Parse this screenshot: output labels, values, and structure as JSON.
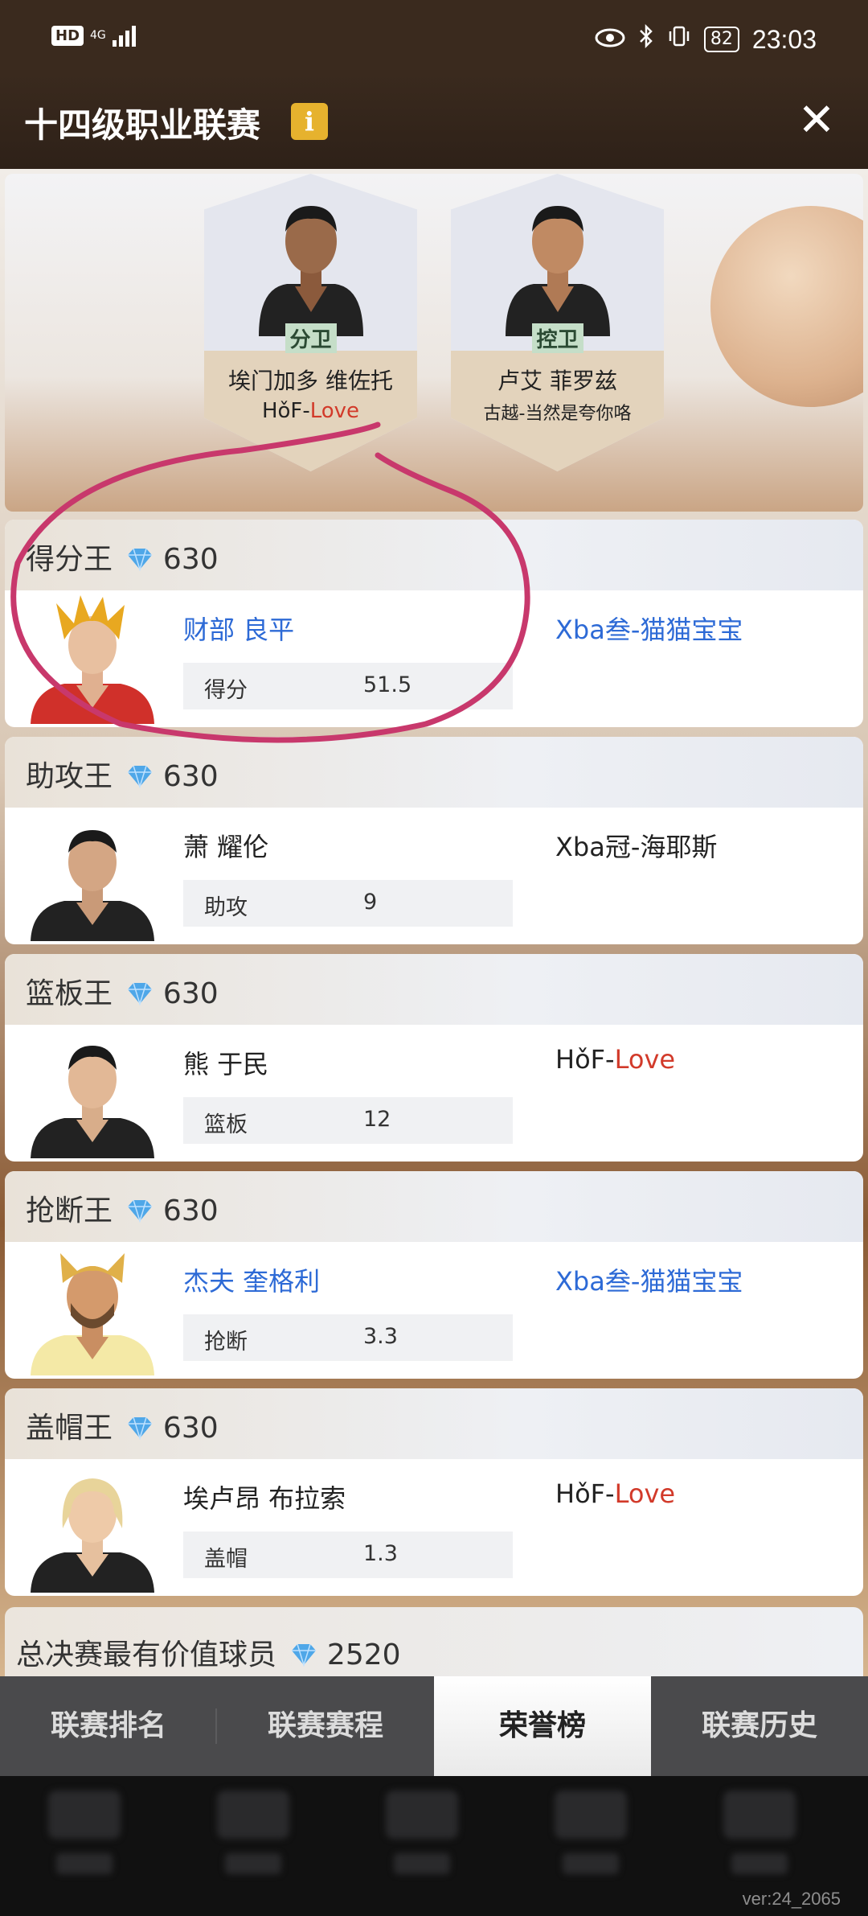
{
  "status_bar": {
    "hd": "HD",
    "network": "4G",
    "battery": "82",
    "time": "23:03"
  },
  "header": {
    "title": "十四级职业联赛",
    "info_icon": "info-icon",
    "info_glyph": "i",
    "close_icon": "close-icon",
    "close_glyph": "✕"
  },
  "banner": {
    "cards": [
      {
        "position": "分卫",
        "player": "埃门加多 维佐托",
        "team_prefix": "HǒF-",
        "team_suffix": "Love"
      },
      {
        "position": "控卫",
        "player": "卢艾 菲罗兹",
        "team": "古越-当然是夸你咯"
      }
    ]
  },
  "awards": [
    {
      "title": "得分王",
      "reward": "630",
      "player": "财部 良平",
      "team": "Xba叁-猫猫宝宝",
      "stat_label": "得分",
      "stat_value": "51.5"
    },
    {
      "title": "助攻王",
      "reward": "630",
      "player": "萧 耀伦",
      "team": "Xba冠-海耶斯",
      "stat_label": "助攻",
      "stat_value": "9"
    },
    {
      "title": "篮板王",
      "reward": "630",
      "player": "熊 于民",
      "team_prefix": "HǒF-",
      "team_suffix": "Love",
      "stat_label": "篮板",
      "stat_value": "12"
    },
    {
      "title": "抢断王",
      "reward": "630",
      "player": "杰夫 奎格利",
      "team": "Xba叁-猫猫宝宝",
      "stat_label": "抢断",
      "stat_value": "3.3"
    },
    {
      "title": "盖帽王",
      "reward": "630",
      "player": "埃卢昂 布拉索",
      "team_prefix": "HǒF-",
      "team_suffix": "Love",
      "stat_label": "盖帽",
      "stat_value": "1.3"
    }
  ],
  "finals_mvp": {
    "title": "总决赛最有价值球员",
    "reward": "2520"
  },
  "tabs": [
    {
      "label": "联赛排名",
      "active": false
    },
    {
      "label": "联赛赛程",
      "active": false
    },
    {
      "label": "荣誉榜",
      "active": true
    },
    {
      "label": "联赛历史",
      "active": false
    }
  ],
  "version": "ver:24_2065",
  "colors": {
    "accent_blue": "#2d6ad6",
    "accent_red": "#d23a2a",
    "info_yellow": "#e6b22e",
    "annotation": "#c8386c"
  }
}
